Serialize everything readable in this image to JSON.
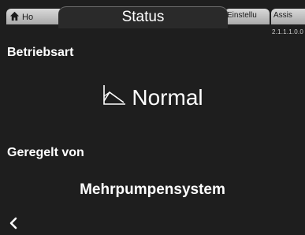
{
  "tabs": [
    {
      "label": "Ho",
      "icon": "home-icon"
    },
    {
      "label": "Status",
      "active": true
    },
    {
      "label": "Einstellu"
    },
    {
      "label": "Assis"
    }
  ],
  "menu_id": "2.1.1.1.0.0",
  "sections": {
    "operating_mode": {
      "label": "Betriebsart",
      "value": "Normal",
      "icon": "curve-chart-icon"
    },
    "controlled_by": {
      "label": "Geregelt von",
      "value": "Mehrpumpensystem"
    }
  },
  "nav": {
    "back_icon": "chevron-left-icon"
  },
  "colors": {
    "background": "#1e1e1e",
    "tab_inactive": "#c8c8c8",
    "text": "#ffffff"
  }
}
